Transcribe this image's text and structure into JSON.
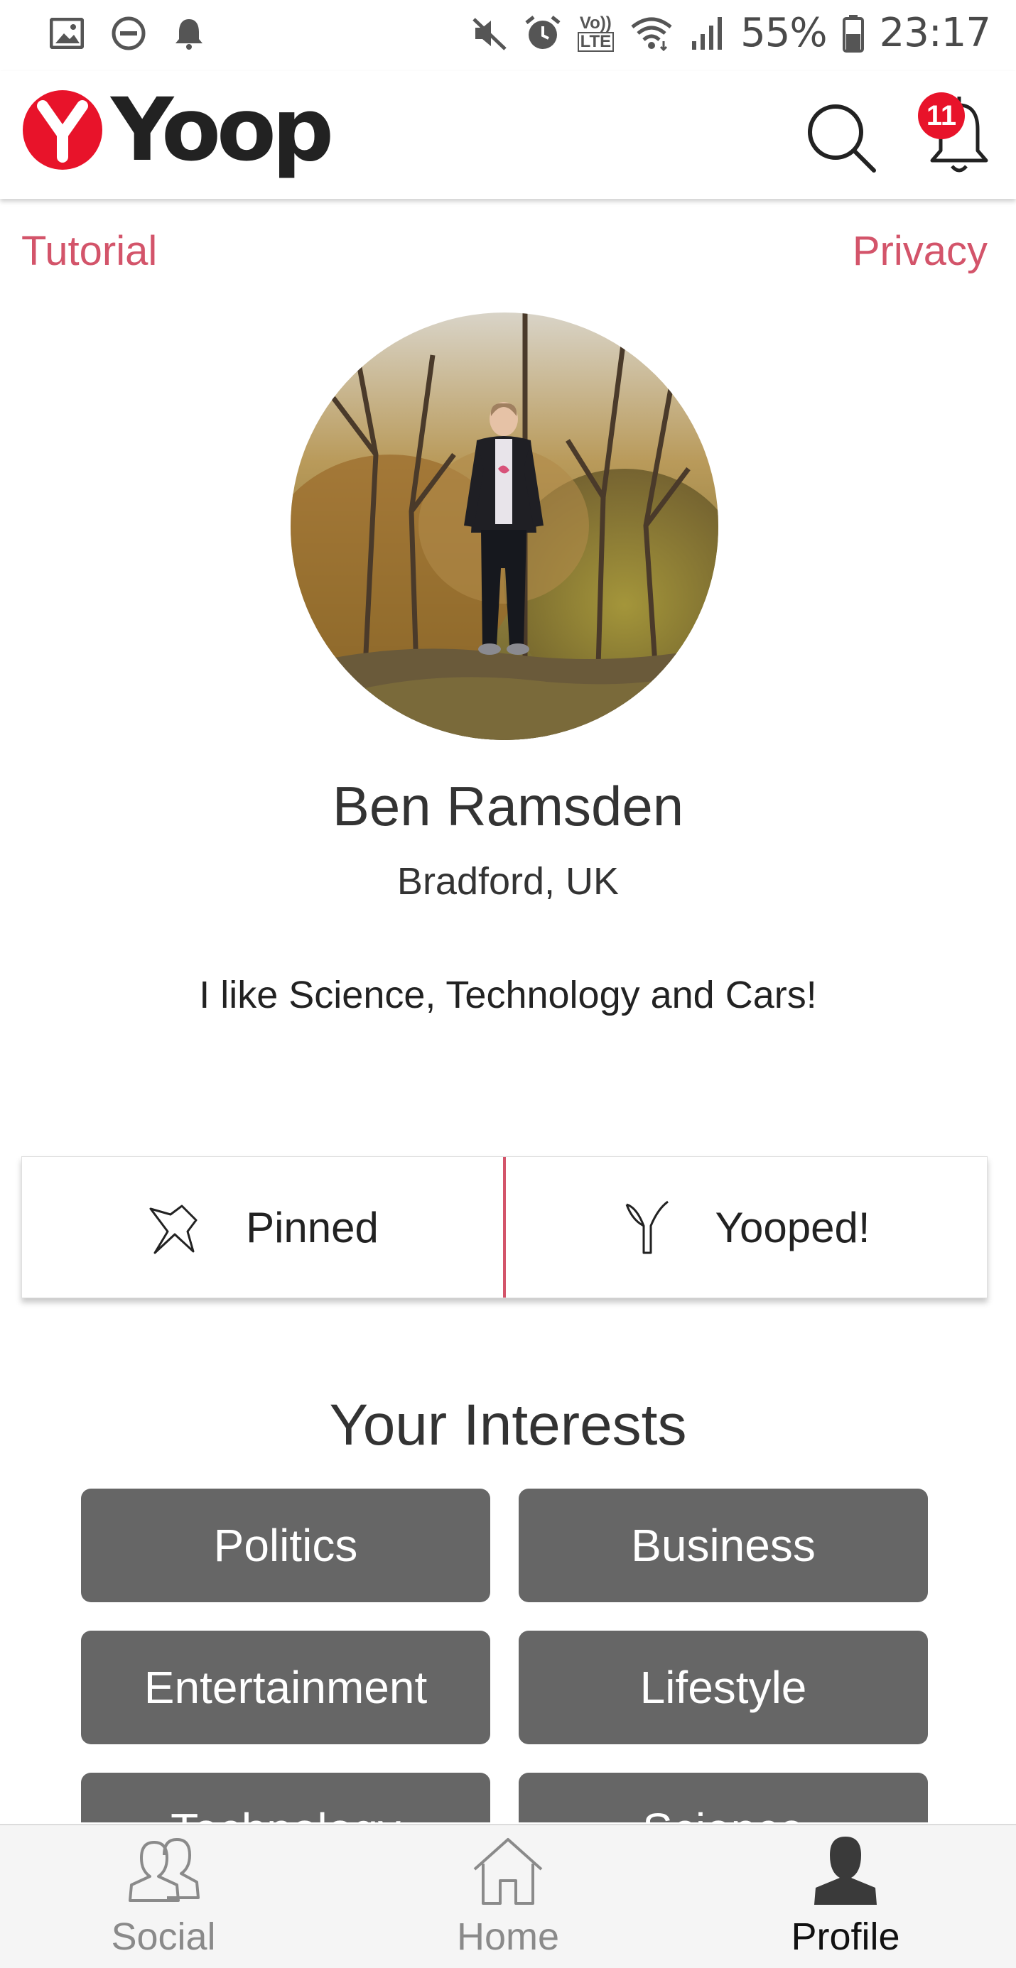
{
  "status_bar": {
    "battery": "55%",
    "time": "23:17",
    "left_icons": [
      "image-icon",
      "dnd-icon",
      "notification-bell-icon"
    ],
    "right_icons": [
      "mute-icon",
      "alarm-icon",
      "volte-icon",
      "wifi-icon",
      "signal-icon",
      "battery-icon"
    ],
    "volte_label_top": "Vo))",
    "volte_label_bottom": "LTE"
  },
  "header": {
    "brand": "Yoop",
    "brand_color": "#e8132a",
    "notification_count": "11"
  },
  "links": {
    "tutorial": "Tutorial",
    "privacy": "Privacy",
    "color": "#d3546a"
  },
  "profile": {
    "name": "Ben Ramsden",
    "location": "Bradford, UK",
    "bio": "I like Science, Technology and Cars!"
  },
  "toggle": {
    "pinned": "Pinned",
    "yooped": "Yooped!"
  },
  "interests": {
    "title": "Your Interests",
    "items": [
      "Politics",
      "Business",
      "Entertainment",
      "Lifestyle",
      "Technology",
      "Science"
    ]
  },
  "bottom_nav": {
    "items": [
      {
        "label": "Social",
        "icon": "social-icon"
      },
      {
        "label": "Home",
        "icon": "home-icon"
      },
      {
        "label": "Profile",
        "icon": "profile-icon"
      }
    ],
    "active": "Profile"
  }
}
